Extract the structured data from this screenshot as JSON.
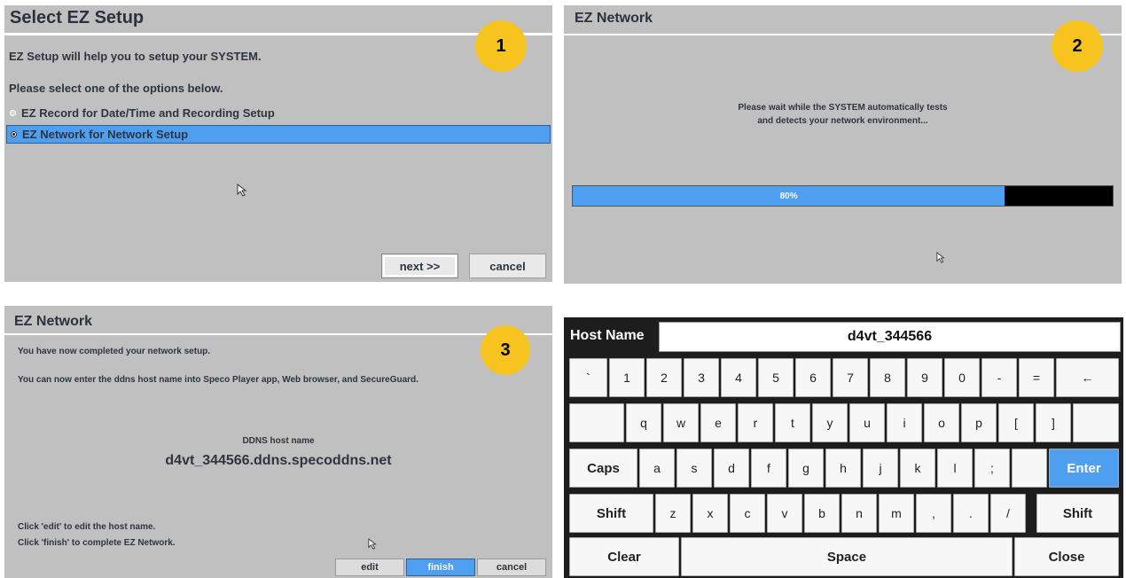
{
  "panel1": {
    "title": "Select EZ Setup",
    "badge": "1",
    "intro": "EZ Setup will help you to setup your SYSTEM.",
    "prompt": "Please select one of the options below.",
    "options": [
      {
        "label": "EZ Record for Date/Time and Recording Setup",
        "selected": false
      },
      {
        "label": "EZ Network for Network Setup",
        "selected": true
      }
    ],
    "next_label": "next >>",
    "cancel_label": "cancel"
  },
  "panel2": {
    "title": "EZ Network",
    "badge": "2",
    "message_line1": "Please wait while the SYSTEM automatically tests",
    "message_line2": "and detects your network environment...",
    "progress_percent": 80,
    "progress_label": "80%"
  },
  "panel3": {
    "title": "EZ Network",
    "badge": "3",
    "line1": "You have now completed your network setup.",
    "line2": "You can now enter the ddns host name into Speco Player app, Web browser, and SecureGuard.",
    "ddns_label": "DDNS host name",
    "ddns_value": "d4vt_344566.ddns.specoddns.net",
    "hint1": "Click 'edit' to edit the host name.",
    "hint2": "Click 'finish' to complete EZ Network.",
    "edit_label": "edit",
    "finish_label": "finish",
    "cancel_label": "cancel"
  },
  "keyboard": {
    "field_label": "Host Name",
    "field_value": "d4vt_344566",
    "row1": [
      "`",
      "1",
      "2",
      "3",
      "4",
      "5",
      "6",
      "7",
      "8",
      "9",
      "0",
      "-",
      "=",
      "←"
    ],
    "row2": [
      "q",
      "w",
      "e",
      "r",
      "t",
      "y",
      "u",
      "i",
      "o",
      "p",
      "[",
      "]"
    ],
    "row3": [
      "Caps",
      "a",
      "s",
      "d",
      "f",
      "g",
      "h",
      "j",
      "k",
      "l",
      ";",
      "Enter"
    ],
    "row4": [
      "Shift",
      "z",
      "x",
      "c",
      "v",
      "b",
      "n",
      "m",
      ",",
      ".",
      "/",
      "Shift"
    ],
    "row5": [
      "Clear",
      "Space",
      "Close"
    ],
    "accent_color": "#4f9ff0"
  },
  "colors": {
    "panel_bg": "#c0c0c0",
    "selection_blue": "#4f9ff0",
    "badge_yellow": "#f7c31f"
  }
}
